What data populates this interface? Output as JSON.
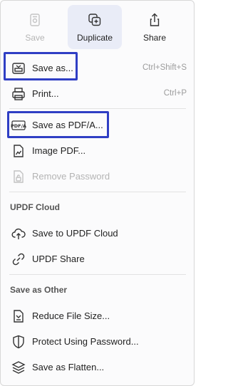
{
  "toolbar": {
    "save_label": "Save",
    "duplicate_label": "Duplicate",
    "share_label": "Share"
  },
  "menu": {
    "save_as": {
      "label": "Save as...",
      "shortcut": "Ctrl+Shift+S"
    },
    "print": {
      "label": "Print...",
      "shortcut": "Ctrl+P"
    },
    "save_as_pdfa": {
      "label": "Save as PDF/A..."
    },
    "image_pdf": {
      "label": "Image PDF..."
    },
    "remove_password": {
      "label": "Remove Password"
    }
  },
  "updf_cloud": {
    "header": "UPDF Cloud",
    "save_to_cloud": "Save to UPDF Cloud",
    "share": "UPDF Share"
  },
  "save_as_other": {
    "header": "Save as Other",
    "reduce": "Reduce File Size...",
    "protect": "Protect Using Password...",
    "flatten": "Save as Flatten..."
  },
  "icons": {
    "save": "save-icon",
    "duplicate": "duplicate-icon",
    "share": "share-icon",
    "save_as": "save-as-icon",
    "print": "printer-icon",
    "pdfa": "pdfa-icon",
    "image_pdf": "image-pdf-icon",
    "remove_password": "unlock-icon",
    "cloud": "cloud-upload-icon",
    "link": "link-icon",
    "reduce": "compress-file-icon",
    "protect": "shield-lock-icon",
    "flatten": "layers-icon"
  },
  "colors": {
    "highlight": "#2f3ec4",
    "active_bg": "#e9ecf7",
    "disabled": "#b4b4b4"
  }
}
